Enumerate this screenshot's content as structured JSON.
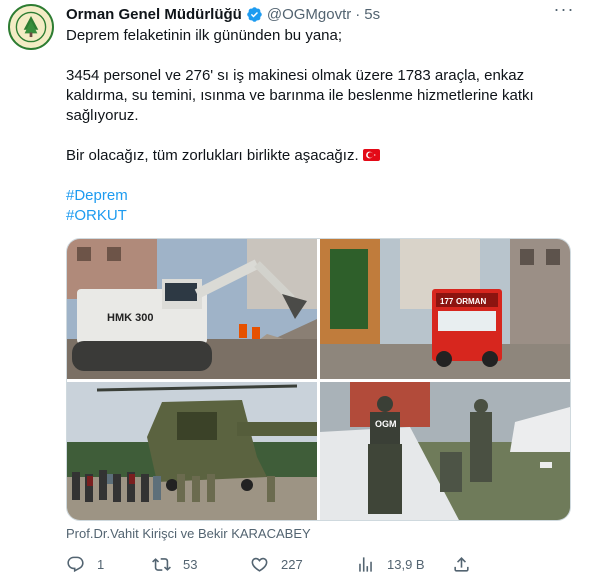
{
  "tweet": {
    "author_name": "Orman Genel Müdürlüğü",
    "handle": "@OGMgovtr",
    "separator": "·",
    "time": "5s",
    "line1": "Deprem felaketinin ilk gününden bu yana;",
    "line2": "3454 personel ve 276' sı iş makinesi olmak üzere 1783 araçla, enkaz kaldırma, su temini, ısınma ve barınma ile beslenme hizmetlerine katkı sağlıyoruz.",
    "line3": "Bir olacağız, tüm zorlukları birlikte aşacağız.",
    "hashtags": [
      "#Deprem",
      "#ORKUT"
    ],
    "tagged_people": "Prof.Dr.Vahit Kirişci ve Bekir KARACABEY"
  },
  "photo_labels": {
    "excavator": "HMK 300",
    "truck_number": "177",
    "truck_label": "ORMAN",
    "tent_label": "OGM"
  },
  "actions": {
    "replies": "1",
    "retweets": "53",
    "likes": "227",
    "views": "13,9 B"
  },
  "icons": {
    "verified": "verified-badge-icon",
    "more": "more-icon",
    "reply": "reply-icon",
    "retweet": "retweet-icon",
    "like": "heart-icon",
    "views": "views-icon",
    "share": "share-icon"
  },
  "colors": {
    "text": "#0f1419",
    "muted": "#536471",
    "link": "#1d9bf0",
    "flag": "#e30a17"
  }
}
